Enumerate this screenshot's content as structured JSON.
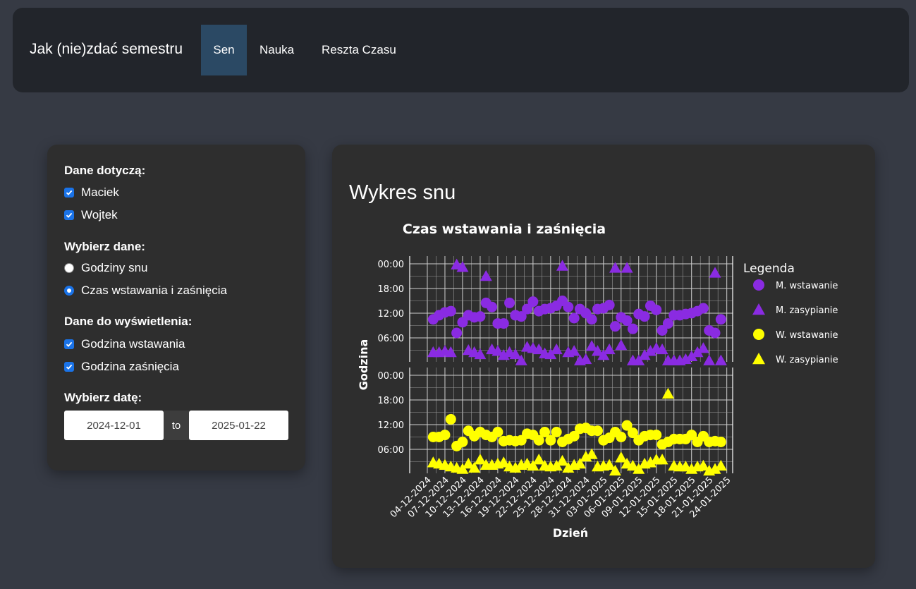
{
  "navbar": {
    "brand": "Jak (nie)zdać semestru",
    "items": [
      {
        "label": "Sen",
        "active": true
      },
      {
        "label": "Nauka",
        "active": false
      },
      {
        "label": "Reszta Czasu",
        "active": false
      }
    ]
  },
  "sidebar": {
    "data_for_title": "Dane dotyczą:",
    "persons": [
      {
        "label": "Maciek",
        "checked": true
      },
      {
        "label": "Wojtek",
        "checked": true
      }
    ],
    "choose_data_title": "Wybierz dane:",
    "data_options": [
      {
        "label": "Godziny snu",
        "selected": false
      },
      {
        "label": "Czas wstawania i zaśnięcia",
        "selected": true
      }
    ],
    "display_title": "Dane do wyświetlenia:",
    "display_options": [
      {
        "label": "Godzina wstawania",
        "checked": true
      },
      {
        "label": "Godzina zaśnięcia",
        "checked": true
      }
    ],
    "date_title": "Wybierz datę:",
    "date_from": "2024-12-01",
    "date_sep": "to",
    "date_to": "2025-01-22"
  },
  "card": {
    "title": "Wykres snu"
  },
  "chart_data": {
    "type": "scatter",
    "title": "Czas wstawania i zaśnięcia",
    "xlabel": "Dzień",
    "ylabel": "Godzina",
    "legend_title": "Legenda",
    "legend_position": "right",
    "grid": true,
    "x_ticks": [
      "04-12-2024",
      "07-12-2024",
      "10-12-2024",
      "13-12-2024",
      "16-12-2024",
      "19-12-2024",
      "22-12-2024",
      "25-12-2024",
      "28-12-2024",
      "31-12-2024",
      "03-01-2025",
      "06-01-2025",
      "09-01-2025",
      "12-01-2025",
      "15-01-2025",
      "18-01-2025",
      "21-01-2025",
      "24-01-2025"
    ],
    "y_ticks": [
      "00:00",
      "18:00",
      "12:00",
      "06:00"
    ],
    "x_range": [
      "2024-12-01",
      "2025-01-25"
    ],
    "series": [
      {
        "name": "M. wstawanie",
        "panel": "top",
        "marker": "circle",
        "color": "#8a2be2",
        "points": [
          [
            "2024-12-05",
            10.5
          ],
          [
            "2024-12-06",
            11.5
          ],
          [
            "2024-12-07",
            12.2
          ],
          [
            "2024-12-08",
            12.5
          ],
          [
            "2024-12-09",
            7.2
          ],
          [
            "2024-12-10",
            9.8
          ],
          [
            "2024-12-11",
            11.5
          ],
          [
            "2024-12-12",
            11.0
          ],
          [
            "2024-12-13",
            11.2
          ],
          [
            "2024-12-14",
            14.5
          ],
          [
            "2024-12-15",
            13.5
          ],
          [
            "2024-12-16",
            9.5
          ],
          [
            "2024-12-17",
            9.5
          ],
          [
            "2024-12-18",
            14.5
          ],
          [
            "2024-12-19",
            11.5
          ],
          [
            "2024-12-20",
            11.2
          ],
          [
            "2024-12-21",
            13.0
          ],
          [
            "2024-12-22",
            14.8
          ],
          [
            "2024-12-23",
            12.5
          ],
          [
            "2024-12-24",
            13.0
          ],
          [
            "2024-12-25",
            13.2
          ],
          [
            "2024-12-26",
            13.8
          ],
          [
            "2024-12-27",
            15.0
          ],
          [
            "2024-12-28",
            13.5
          ],
          [
            "2024-12-29",
            10.8
          ],
          [
            "2024-12-30",
            13.0
          ],
          [
            "2024-12-31",
            12.0
          ],
          [
            "2025-01-01",
            10.5
          ],
          [
            "2025-01-02",
            13.0
          ],
          [
            "2025-01-03",
            13.2
          ],
          [
            "2025-01-04",
            14.0
          ],
          [
            "2025-01-05",
            8.8
          ],
          [
            "2025-01-06",
            11.0
          ],
          [
            "2025-01-07",
            10.2
          ],
          [
            "2025-01-08",
            8.2
          ],
          [
            "2025-01-09",
            11.8
          ],
          [
            "2025-01-10",
            11.2
          ],
          [
            "2025-01-11",
            13.8
          ],
          [
            "2025-01-12",
            12.8
          ],
          [
            "2025-01-13",
            7.8
          ],
          [
            "2025-01-14",
            9.5
          ],
          [
            "2025-01-15",
            11.5
          ],
          [
            "2025-01-16",
            11.5
          ],
          [
            "2025-01-17",
            11.8
          ],
          [
            "2025-01-18",
            12.0
          ],
          [
            "2025-01-19",
            12.5
          ],
          [
            "2025-01-20",
            13.2
          ],
          [
            "2025-01-21",
            7.8
          ],
          [
            "2025-01-22",
            7.2
          ],
          [
            "2025-01-23",
            10.5
          ]
        ]
      },
      {
        "name": "M. zasypianie",
        "panel": "top",
        "marker": "triangle",
        "color": "#8a2be2",
        "points": [
          [
            "2024-12-05",
            2.5
          ],
          [
            "2024-12-06",
            2.5
          ],
          [
            "2024-12-07",
            2.8
          ],
          [
            "2024-12-08",
            2.5
          ],
          [
            "2024-12-09",
            23.8
          ],
          [
            "2024-12-10",
            23.2
          ],
          [
            "2024-12-11",
            3.0
          ],
          [
            "2024-12-12",
            2.5
          ],
          [
            "2024-12-13",
            2.0
          ],
          [
            "2024-12-14",
            21.0
          ],
          [
            "2024-12-15",
            3.2
          ],
          [
            "2024-12-16",
            2.8
          ],
          [
            "2024-12-17",
            1.8
          ],
          [
            "2024-12-18",
            2.5
          ],
          [
            "2024-12-19",
            2.0
          ],
          [
            "2024-12-20",
            0.5
          ],
          [
            "2024-12-21",
            3.8
          ],
          [
            "2024-12-22",
            3.5
          ],
          [
            "2024-12-23",
            3.2
          ],
          [
            "2024-12-24",
            2.2
          ],
          [
            "2024-12-25",
            2.0
          ],
          [
            "2024-12-26",
            3.2
          ],
          [
            "2024-12-27",
            23.5
          ],
          [
            "2024-12-28",
            2.5
          ],
          [
            "2024-12-29",
            2.8
          ],
          [
            "2024-12-30",
            0.5
          ],
          [
            "2024-12-31",
            0.8
          ],
          [
            "2025-01-01",
            4.0
          ],
          [
            "2025-01-02",
            2.8
          ],
          [
            "2025-01-03",
            1.8
          ],
          [
            "2025-01-04",
            3.2
          ],
          [
            "2025-01-05",
            23.0
          ],
          [
            "2025-01-06",
            4.2
          ],
          [
            "2025-01-07",
            23.0
          ],
          [
            "2025-01-08",
            0.5
          ],
          [
            "2025-01-09",
            0.5
          ],
          [
            "2025-01-10",
            1.8
          ],
          [
            "2025-01-11",
            2.8
          ],
          [
            "2025-01-12",
            3.5
          ],
          [
            "2025-01-13",
            3.2
          ],
          [
            "2025-01-14",
            0.5
          ],
          [
            "2025-01-15",
            0.5
          ],
          [
            "2025-01-16",
            0.5
          ],
          [
            "2025-01-17",
            0.8
          ],
          [
            "2025-01-18",
            1.5
          ],
          [
            "2025-01-19",
            2.5
          ],
          [
            "2025-01-20",
            3.5
          ],
          [
            "2025-01-21",
            0.5
          ],
          [
            "2025-01-22",
            21.8
          ],
          [
            "2025-01-23",
            0.5
          ]
        ]
      },
      {
        "name": "W. wstawanie",
        "panel": "bottom",
        "marker": "circle",
        "color": "#ffff00",
        "points": [
          [
            "2024-12-05",
            9.0
          ],
          [
            "2024-12-06",
            9.0
          ],
          [
            "2024-12-07",
            9.5
          ],
          [
            "2024-12-08",
            13.3
          ],
          [
            "2024-12-09",
            6.8
          ],
          [
            "2024-12-10",
            7.8
          ],
          [
            "2024-12-11",
            10.5
          ],
          [
            "2024-12-12",
            9.2
          ],
          [
            "2024-12-13",
            10.2
          ],
          [
            "2024-12-14",
            9.5
          ],
          [
            "2024-12-15",
            9.0
          ],
          [
            "2024-12-16",
            10.2
          ],
          [
            "2024-12-17",
            8.0
          ],
          [
            "2024-12-18",
            8.2
          ],
          [
            "2024-12-19",
            8.0
          ],
          [
            "2024-12-20",
            8.2
          ],
          [
            "2024-12-21",
            9.8
          ],
          [
            "2024-12-22",
            9.5
          ],
          [
            "2024-12-23",
            8.2
          ],
          [
            "2024-12-24",
            10.2
          ],
          [
            "2024-12-25",
            8.2
          ],
          [
            "2024-12-26",
            10.2
          ],
          [
            "2024-12-27",
            7.8
          ],
          [
            "2024-12-28",
            8.5
          ],
          [
            "2024-12-29",
            9.2
          ],
          [
            "2024-12-30",
            11.0
          ],
          [
            "2024-12-31",
            11.2
          ],
          [
            "2025-01-01",
            10.5
          ],
          [
            "2025-01-02",
            10.5
          ],
          [
            "2025-01-03",
            8.2
          ],
          [
            "2025-01-04",
            8.8
          ],
          [
            "2025-01-05",
            10.2
          ],
          [
            "2025-01-06",
            9.0
          ],
          [
            "2025-01-07",
            11.8
          ],
          [
            "2025-01-08",
            10.0
          ],
          [
            "2025-01-09",
            8.2
          ],
          [
            "2025-01-10",
            9.2
          ],
          [
            "2025-01-11",
            9.5
          ],
          [
            "2025-01-12",
            9.5
          ],
          [
            "2025-01-13",
            7.2
          ],
          [
            "2025-01-14",
            7.8
          ],
          [
            "2025-01-15",
            8.5
          ],
          [
            "2025-01-16",
            8.5
          ],
          [
            "2025-01-17",
            8.5
          ],
          [
            "2025-01-18",
            9.5
          ],
          [
            "2025-01-19",
            7.8
          ],
          [
            "2025-01-20",
            9.2
          ],
          [
            "2025-01-21",
            7.8
          ],
          [
            "2025-01-22",
            8.0
          ],
          [
            "2025-01-23",
            7.8
          ]
        ]
      },
      {
        "name": "W. zasypianie",
        "panel": "bottom",
        "marker": "triangle",
        "color": "#ffff00",
        "points": [
          [
            "2024-12-05",
            2.8
          ],
          [
            "2024-12-06",
            2.5
          ],
          [
            "2024-12-07",
            2.2
          ],
          [
            "2024-12-08",
            1.8
          ],
          [
            "2024-12-09",
            1.5
          ],
          [
            "2024-12-10",
            1.2
          ],
          [
            "2024-12-11",
            2.5
          ],
          [
            "2024-12-12",
            1.5
          ],
          [
            "2024-12-13",
            3.5
          ],
          [
            "2024-12-14",
            2.2
          ],
          [
            "2024-12-15",
            2.2
          ],
          [
            "2024-12-16",
            2.5
          ],
          [
            "2024-12-17",
            2.8
          ],
          [
            "2024-12-18",
            1.8
          ],
          [
            "2024-12-19",
            1.5
          ],
          [
            "2024-12-20",
            2.2
          ],
          [
            "2024-12-21",
            2.5
          ],
          [
            "2024-12-22",
            2.0
          ],
          [
            "2024-12-23",
            3.5
          ],
          [
            "2024-12-24",
            2.0
          ],
          [
            "2024-12-25",
            1.8
          ],
          [
            "2024-12-26",
            2.0
          ],
          [
            "2024-12-27",
            3.2
          ],
          [
            "2024-12-28",
            1.5
          ],
          [
            "2024-12-29",
            2.2
          ],
          [
            "2024-12-30",
            2.5
          ],
          [
            "2024-12-31",
            4.2
          ],
          [
            "2025-01-01",
            4.8
          ],
          [
            "2025-01-02",
            1.8
          ],
          [
            "2025-01-03",
            2.0
          ],
          [
            "2025-01-04",
            2.2
          ],
          [
            "2025-01-05",
            0.8
          ],
          [
            "2025-01-06",
            4.0
          ],
          [
            "2025-01-07",
            2.5
          ],
          [
            "2025-01-08",
            2.0
          ],
          [
            "2025-01-09",
            1.2
          ],
          [
            "2025-01-10",
            2.5
          ],
          [
            "2025-01-11",
            2.8
          ],
          [
            "2025-01-12",
            3.5
          ],
          [
            "2025-01-13",
            3.5
          ],
          [
            "2025-01-14",
            19.5
          ],
          [
            "2025-01-15",
            2.0
          ],
          [
            "2025-01-16",
            1.8
          ],
          [
            "2025-01-17",
            1.8
          ],
          [
            "2025-01-18",
            1.2
          ],
          [
            "2025-01-19",
            1.8
          ],
          [
            "2025-01-20",
            2.0
          ],
          [
            "2025-01-21",
            0.8
          ],
          [
            "2025-01-22",
            1.2
          ],
          [
            "2025-01-23",
            2.0
          ]
        ]
      }
    ]
  }
}
